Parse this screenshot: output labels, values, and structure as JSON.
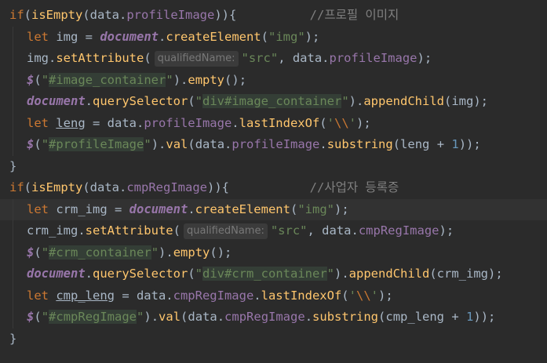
{
  "editor": {
    "background": "#2b2b2b",
    "lines": [
      {
        "tokens": [
          {
            "t": "if",
            "c": "kw"
          },
          {
            "t": "(",
            "c": "pun"
          },
          {
            "t": "isEmpty",
            "c": "fn"
          },
          {
            "t": "(data.",
            "c": "pun"
          },
          {
            "t": "profileImage",
            "c": "prop"
          },
          {
            "t": ")){",
            "c": "pun"
          },
          {
            "t": "          ",
            "c": "pun"
          },
          {
            "t": "//프로필 이미지",
            "c": "cmt"
          }
        ]
      },
      {
        "indent": true,
        "tokens": [
          {
            "t": "let ",
            "c": "kw"
          },
          {
            "t": "img = ",
            "c": "var"
          },
          {
            "t": "document",
            "c": "glob"
          },
          {
            "t": ".",
            "c": "pun"
          },
          {
            "t": "createElement",
            "c": "fn"
          },
          {
            "t": "(",
            "c": "pun"
          },
          {
            "t": "\"img\"",
            "c": "str"
          },
          {
            "t": ");",
            "c": "pun"
          }
        ]
      },
      {
        "indent": true,
        "tokens": [
          {
            "t": "img.",
            "c": "var"
          },
          {
            "t": "setAttribute",
            "c": "fn"
          },
          {
            "t": "(",
            "c": "pun"
          },
          {
            "t": "qualifiedName:",
            "c": "hint"
          },
          {
            "t": "\"src\"",
            "c": "str"
          },
          {
            "t": ", data.",
            "c": "pun"
          },
          {
            "t": "profileImage",
            "c": "prop"
          },
          {
            "t": ");",
            "c": "pun"
          }
        ]
      },
      {
        "indent": true,
        "tokens": [
          {
            "t": "$",
            "c": "glob"
          },
          {
            "t": "(",
            "c": "pun"
          },
          {
            "t": "\"",
            "c": "str"
          },
          {
            "t": "#image_container",
            "c": "strhl"
          },
          {
            "t": "\"",
            "c": "str"
          },
          {
            "t": ").",
            "c": "pun"
          },
          {
            "t": "empty",
            "c": "fn"
          },
          {
            "t": "();",
            "c": "pun"
          }
        ]
      },
      {
        "indent": true,
        "tokens": [
          {
            "t": "document",
            "c": "glob"
          },
          {
            "t": ".",
            "c": "pun"
          },
          {
            "t": "querySelector",
            "c": "fn"
          },
          {
            "t": "(",
            "c": "pun"
          },
          {
            "t": "\"",
            "c": "str"
          },
          {
            "t": "div#image_container",
            "c": "strhl"
          },
          {
            "t": "\"",
            "c": "str"
          },
          {
            "t": ").",
            "c": "pun"
          },
          {
            "t": "appendChild",
            "c": "fn"
          },
          {
            "t": "(img);",
            "c": "pun"
          }
        ]
      },
      {
        "indent": true,
        "tokens": [
          {
            "t": "let ",
            "c": "kw"
          },
          {
            "t": "leng",
            "c": "ul"
          },
          {
            "t": " = data.",
            "c": "pun"
          },
          {
            "t": "profileImage",
            "c": "prop"
          },
          {
            "t": ".",
            "c": "pun"
          },
          {
            "t": "lastIndexOf",
            "c": "fn"
          },
          {
            "t": "(",
            "c": "pun"
          },
          {
            "t": "'",
            "c": "str"
          },
          {
            "t": "\\\\",
            "c": "esc"
          },
          {
            "t": "'",
            "c": "str"
          },
          {
            "t": ");",
            "c": "pun"
          }
        ]
      },
      {
        "indent": true,
        "tokens": [
          {
            "t": "$",
            "c": "glob"
          },
          {
            "t": "(",
            "c": "pun"
          },
          {
            "t": "\"",
            "c": "str"
          },
          {
            "t": "#profileImage",
            "c": "strhl"
          },
          {
            "t": "\"",
            "c": "str"
          },
          {
            "t": ").",
            "c": "pun"
          },
          {
            "t": "val",
            "c": "fn"
          },
          {
            "t": "(data.",
            "c": "pun"
          },
          {
            "t": "profileImage",
            "c": "prop"
          },
          {
            "t": ".",
            "c": "pun"
          },
          {
            "t": "substring",
            "c": "fn"
          },
          {
            "t": "(leng + ",
            "c": "pun"
          },
          {
            "t": "1",
            "c": "num"
          },
          {
            "t": "));",
            "c": "pun"
          }
        ]
      },
      {
        "tokens": [
          {
            "t": "}",
            "c": "pun"
          }
        ]
      },
      {
        "tokens": [
          {
            "t": "if",
            "c": "kw"
          },
          {
            "t": "(",
            "c": "pun"
          },
          {
            "t": "isEmpty",
            "c": "fn"
          },
          {
            "t": "(data.",
            "c": "pun"
          },
          {
            "t": "cmpRegImage",
            "c": "prop"
          },
          {
            "t": ")){",
            "c": "pun"
          },
          {
            "t": "           ",
            "c": "pun"
          },
          {
            "t": "//사업자 등록증",
            "c": "cmt"
          }
        ]
      },
      {
        "indent": true,
        "caret": true,
        "tokens": [
          {
            "t": "let ",
            "c": "kw"
          },
          {
            "t": "crm_img = ",
            "c": "var"
          },
          {
            "t": "document",
            "c": "glob"
          },
          {
            "t": ".",
            "c": "pun"
          },
          {
            "t": "createElement",
            "c": "fn"
          },
          {
            "t": "(",
            "c": "pun"
          },
          {
            "t": "\"img\"",
            "c": "str"
          },
          {
            "t": ");",
            "c": "pun"
          }
        ]
      },
      {
        "indent": true,
        "tokens": [
          {
            "t": "crm_img.",
            "c": "var"
          },
          {
            "t": "setAttribute",
            "c": "fn"
          },
          {
            "t": "(",
            "c": "pun"
          },
          {
            "t": "qualifiedName:",
            "c": "hint"
          },
          {
            "t": "\"src\"",
            "c": "str"
          },
          {
            "t": ", data.",
            "c": "pun"
          },
          {
            "t": "cmpRegImage",
            "c": "prop"
          },
          {
            "t": ");",
            "c": "pun"
          }
        ]
      },
      {
        "indent": true,
        "tokens": [
          {
            "t": "$",
            "c": "glob"
          },
          {
            "t": "(",
            "c": "pun"
          },
          {
            "t": "\"",
            "c": "str"
          },
          {
            "t": "#crm_container",
            "c": "strhl"
          },
          {
            "t": "\"",
            "c": "str"
          },
          {
            "t": ").",
            "c": "pun"
          },
          {
            "t": "empty",
            "c": "fn"
          },
          {
            "t": "();",
            "c": "pun"
          }
        ]
      },
      {
        "indent": true,
        "tokens": [
          {
            "t": "document",
            "c": "glob"
          },
          {
            "t": ".",
            "c": "pun"
          },
          {
            "t": "querySelector",
            "c": "fn"
          },
          {
            "t": "(",
            "c": "pun"
          },
          {
            "t": "\"",
            "c": "str"
          },
          {
            "t": "div#crm_container",
            "c": "strhl"
          },
          {
            "t": "\"",
            "c": "str"
          },
          {
            "t": ").",
            "c": "pun"
          },
          {
            "t": "appendChild",
            "c": "fn"
          },
          {
            "t": "(crm_img);",
            "c": "pun"
          }
        ]
      },
      {
        "indent": true,
        "tokens": [
          {
            "t": "let ",
            "c": "kw"
          },
          {
            "t": "cmp_leng",
            "c": "ul"
          },
          {
            "t": " = data.",
            "c": "pun"
          },
          {
            "t": "cmpRegImage",
            "c": "prop"
          },
          {
            "t": ".",
            "c": "pun"
          },
          {
            "t": "lastIndexOf",
            "c": "fn"
          },
          {
            "t": "(",
            "c": "pun"
          },
          {
            "t": "'",
            "c": "str"
          },
          {
            "t": "\\\\",
            "c": "esc"
          },
          {
            "t": "'",
            "c": "str"
          },
          {
            "t": ");",
            "c": "pun"
          }
        ]
      },
      {
        "indent": true,
        "tokens": [
          {
            "t": "$",
            "c": "glob"
          },
          {
            "t": "(",
            "c": "pun"
          },
          {
            "t": "\"",
            "c": "str"
          },
          {
            "t": "#cmpRegImage",
            "c": "strhl"
          },
          {
            "t": "\"",
            "c": "str"
          },
          {
            "t": ").",
            "c": "pun"
          },
          {
            "t": "val",
            "c": "fn"
          },
          {
            "t": "(data.",
            "c": "pun"
          },
          {
            "t": "cmpRegImage",
            "c": "prop"
          },
          {
            "t": ".",
            "c": "pun"
          },
          {
            "t": "substring",
            "c": "fn"
          },
          {
            "t": "(cmp_leng + ",
            "c": "pun"
          },
          {
            "t": "1",
            "c": "num"
          },
          {
            "t": "));",
            "c": "pun"
          }
        ]
      },
      {
        "tokens": [
          {
            "t": "}",
            "c": "pun"
          }
        ]
      }
    ]
  }
}
